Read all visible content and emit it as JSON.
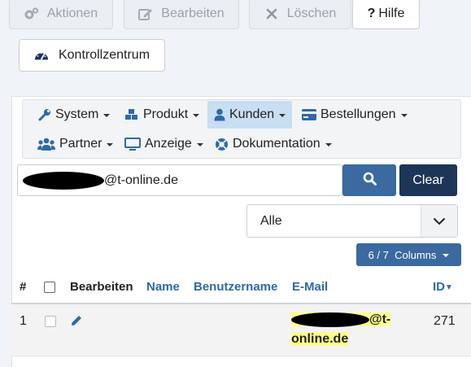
{
  "toolbar": {
    "aktionen": "Aktionen",
    "bearbeiten": "Bearbeiten",
    "loeschen": "Löschen",
    "hilfe": "Hilfe",
    "kontrollzentrum": "Kontrollzentrum"
  },
  "menu": {
    "items": [
      {
        "label": "System",
        "icon": "wrench-icon"
      },
      {
        "label": "Produkt",
        "icon": "cubes-icon"
      },
      {
        "label": "Kunden",
        "icon": "user-icon"
      },
      {
        "label": "Bestellungen",
        "icon": "credit-card-icon"
      },
      {
        "label": "Partner",
        "icon": "users-icon"
      },
      {
        "label": "Anzeige",
        "icon": "monitor-icon"
      },
      {
        "label": "Dokumentation",
        "icon": "lifebuoy-icon"
      }
    ],
    "selected": "Kunden"
  },
  "search": {
    "value_suffix": "@t-online.de",
    "clear_label": "Clear"
  },
  "filter": {
    "selected": "Alle"
  },
  "columns_button": {
    "label": "6 / 7  Columns"
  },
  "table": {
    "headers": {
      "num": "#",
      "edit": "Bearbeiten",
      "name": "Name",
      "username": "Benutzername",
      "email": "E-Mail",
      "id": "ID"
    },
    "rows": [
      {
        "num": "1",
        "email_line1_suffix": "@t-",
        "email_line2": "online.de",
        "id": "271"
      }
    ]
  },
  "colors": {
    "primary": "#3a6aa0",
    "dark": "#1d3557",
    "link": "#2e6aa8",
    "highlight": "#fffd8c",
    "menu_selected": "#c8def2"
  }
}
